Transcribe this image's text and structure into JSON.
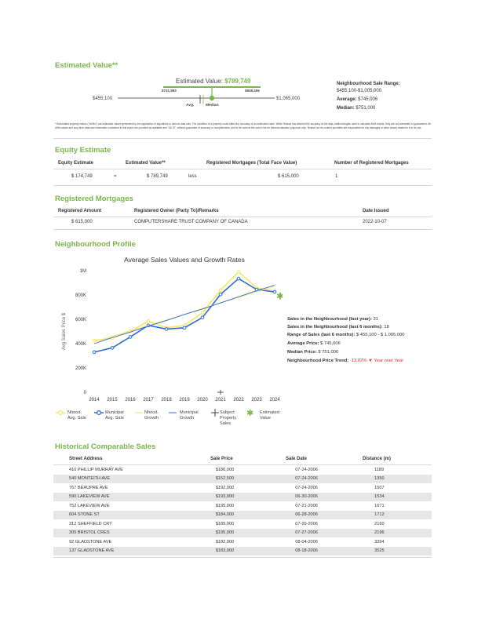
{
  "estimated_value": {
    "section_title": "Estimated Value**",
    "headline_label": "Estimated Value:",
    "headline_value": "$789,749",
    "range_low_bar": "$731,993",
    "range_high_bar": "$848,406",
    "min_label": "$455,100",
    "max_label": "$1,065,000",
    "avg_label": "Avg.",
    "median_label": "Median",
    "sale_range_title": "Neighbourhood Sale Range:",
    "sale_range_value": "$455,100-$1,005,000",
    "average_label": "Average:",
    "average_value": "$745,006",
    "median_label2": "Median:",
    "median_value": "$751,000",
    "disclaimer": "**Automated property values (\"AVMs\") are estimated values generated by the application of algorithms to various data sets. The condition of a property could affect the accuracy of an estimated value. While Teranet has deemed the accuracy of the data, methodologies used to calculate AVM results, they are not warranted or guaranteed. All AVM values and any other data and information contained in this report are provided as available and \"AS IS\", without guarantee of accuracy or completeness, and to be used at the user's risk for internal valuation purposes only. Teranet nor its content providers are responsible for any damages or other losses related to it or its use."
  },
  "equity": {
    "section_title": "Equity Estimate",
    "headers": [
      "Equity Estimate",
      "Estimated Value**",
      "Registered Mortgages (Total Face Value)",
      "Number of Registered Mortgages"
    ],
    "equity_value": "$ 174,749",
    "equals": "=",
    "estimated_value": "$ 789,749",
    "less": "less",
    "mortgages_total": "$ 615,000",
    "mortgage_count": "1"
  },
  "mortgages": {
    "section_title": "Registered Mortgages",
    "headers": [
      "Registered Amount",
      "Registered Owner (Party To)/Remarks",
      "Date Issued"
    ],
    "rows": [
      {
        "amount": "$ 615,000",
        "owner": "COMPUTERSHARE TRUST COMPANY OF CANADA",
        "date": "2022-10-07"
      }
    ]
  },
  "neighbourhood": {
    "section_title": "Neighbourhood Profile",
    "stats": [
      {
        "label": "Sales in the Neighbourhood (last year):",
        "value": "31"
      },
      {
        "label": "Sales in the Neighbourhood (last 6 months):",
        "value": "18"
      },
      {
        "label": "Range of Sales (last 6 months):",
        "value": "$ 455,100 - $ 1,005,000"
      },
      {
        "label": "Average Price:",
        "value": "$ 745,006"
      },
      {
        "label": "Median Price:",
        "value": "$ 751,000"
      },
      {
        "label": "Neighbourhood Price Trend:",
        "value": "-13.02% ▼ Year over Year"
      }
    ]
  },
  "chart_data": {
    "type": "line",
    "title": "Average Sales Values and Growth Rates",
    "ylabel": "Avg Sales Price $",
    "xlabel": "",
    "x": [
      2014,
      2015,
      2016,
      2017,
      2018,
      2019,
      2020,
      2021,
      2022,
      2023,
      2024
    ],
    "ylim": [
      0,
      1000000
    ],
    "yticks": [
      0,
      200000,
      400000,
      600000,
      800000,
      1000000
    ],
    "ytick_labels": [
      "0",
      "200K",
      "400K",
      "600K",
      "800K",
      "1M"
    ],
    "grid": false,
    "series": [
      {
        "name": "Nhood. Avg. Sale",
        "color": "#f7e463",
        "values": [
          425000,
          445000,
          500000,
          585000,
          530000,
          550000,
          655000,
          840000,
          990000,
          860000,
          830000
        ]
      },
      {
        "name": "Municipal Avg. Sale",
        "color": "#2e6bd6",
        "values": [
          330000,
          365000,
          455000,
          550000,
          520000,
          530000,
          615000,
          805000,
          935000,
          845000,
          825000
        ]
      },
      {
        "name": "Nhood. Growth",
        "color": "#f7e463",
        "values": [
          415000,
          460000,
          505000,
          550000,
          595000,
          640000,
          690000,
          735000,
          780000,
          825000,
          870000
        ]
      },
      {
        "name": "Municipal Growth",
        "color": "#2e6bd6",
        "values": [
          400000,
          450000,
          495000,
          545000,
          590000,
          640000,
          685000,
          735000,
          785000,
          835000,
          880000
        ]
      }
    ],
    "subject_property_year": 2021,
    "estimated_value": {
      "year": 2024,
      "value": 789749
    },
    "legend": [
      {
        "name": "Nhood.\nAvg. Sale"
      },
      {
        "name": "Municipal\nAvg. Sale"
      },
      {
        "name": "Nhood.\nGrowth"
      },
      {
        "name": "Municipal\nGrowth"
      },
      {
        "name": "Subject\nProperty\nSales"
      },
      {
        "name": "Estimated\nValue"
      }
    ],
    "colors": {
      "accent": "#7ab648",
      "yellow": "#f7e463",
      "blue": "#2e6bd6"
    }
  },
  "comparables": {
    "section_title": "Historical Comparable Sales",
    "headers": [
      "Street Address",
      "Sale Price",
      "Sale Date",
      "Distance (m)"
    ],
    "rows": [
      [
        "410 PHILLIP MURRAY AVE",
        "$186,000",
        "07-24-2006",
        "1189"
      ],
      [
        "540 MONTEITH AVE",
        "$152,500",
        "07-24-2006",
        "1350"
      ],
      [
        "767 BEAUPRE AVE",
        "$192,000",
        "07-24-2006",
        "1507"
      ],
      [
        "590 LAKEVIEW AVE",
        "$193,000",
        "06-30-2006",
        "1534"
      ],
      [
        "752 LAKEVIEW AVE",
        "$195,000",
        "07-21-2006",
        "1671"
      ],
      [
        "604 STONE ST",
        "$184,000",
        "06-28-2006",
        "1712"
      ],
      [
        "312 SHEFFIELD CRT",
        "$189,000",
        "07-26-2006",
        "2160"
      ],
      [
        "305 BRISTOL CRES",
        "$195,000",
        "07-27-2006",
        "2196"
      ],
      [
        "92 GLADSTONE AVE",
        "$182,000",
        "08-04-2006",
        "3394"
      ],
      [
        "137 GLADSTONE AVE",
        "$183,000",
        "08-18-2006",
        "3525"
      ]
    ]
  }
}
